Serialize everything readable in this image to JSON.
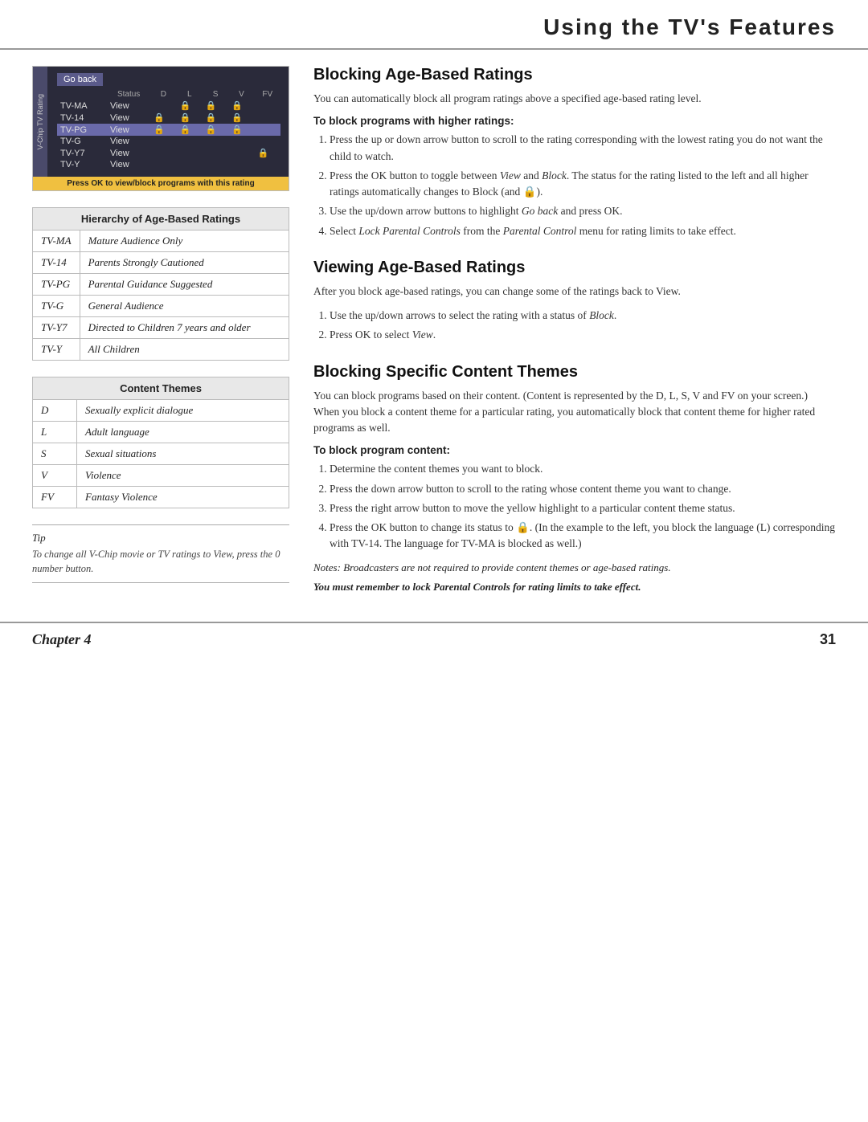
{
  "header": {
    "title": "Using the TV's Features"
  },
  "tv_screen": {
    "sidebar_label": "V-Chip TV Rating",
    "go_back": "Go back",
    "columns": [
      "Status",
      "D",
      "L",
      "S",
      "V",
      "FV"
    ],
    "rows": [
      {
        "rating": "TV-MA",
        "status": "View",
        "d": "",
        "l": "🔒",
        "s": "🔒",
        "v": "🔒",
        "fv": ""
      },
      {
        "rating": "TV-14",
        "status": "View",
        "d": "🔒",
        "l": "🔒",
        "s": "🔒",
        "v": "🔒",
        "fv": ""
      },
      {
        "rating": "TV-PG",
        "status": "View",
        "d": "🔒",
        "l": "🔒",
        "s": "🔒",
        "v": "🔒",
        "fv": "",
        "highlight": true
      },
      {
        "rating": "TV-G",
        "status": "View",
        "d": "",
        "l": "",
        "s": "",
        "v": "",
        "fv": ""
      },
      {
        "rating": "TV-Y7",
        "status": "View",
        "d": "",
        "l": "",
        "s": "",
        "v": "",
        "fv": "🔒"
      },
      {
        "rating": "TV-Y",
        "status": "View",
        "d": "",
        "l": "",
        "s": "",
        "v": "",
        "fv": ""
      }
    ],
    "footer": "Press OK to view/block programs with this rating"
  },
  "hierarchy_table": {
    "header": "Hierarchy of Age-Based Ratings",
    "rows": [
      {
        "code": "TV-MA",
        "description": "Mature Audience Only"
      },
      {
        "code": "TV-14",
        "description": "Parents Strongly Cautioned"
      },
      {
        "code": "TV-PG",
        "description": "Parental Guidance Suggested"
      },
      {
        "code": "TV-G",
        "description": "General Audience"
      },
      {
        "code": "TV-Y7",
        "description": "Directed to Children 7 years and older"
      },
      {
        "code": "TV-Y",
        "description": "All Children"
      }
    ]
  },
  "content_themes_table": {
    "header": "Content Themes",
    "rows": [
      {
        "code": "D",
        "description": "Sexually explicit dialogue"
      },
      {
        "code": "L",
        "description": "Adult language"
      },
      {
        "code": "S",
        "description": "Sexual situations"
      },
      {
        "code": "V",
        "description": "Violence"
      },
      {
        "code": "FV",
        "description": "Fantasy Violence"
      }
    ]
  },
  "blocking_age": {
    "title": "Blocking Age-Based Ratings",
    "intro": "You can automatically block all program ratings above a specified age-based rating level.",
    "subhead": "To block programs with higher ratings:",
    "steps": [
      "Press the up or down arrow button to scroll to the rating corresponding with the lowest rating you do not want the child to watch.",
      "Press the OK button to toggle between View and Block. The status for the rating listed to the left and all higher ratings automatically changes to Block (and 🔒).",
      "Use the up/down arrow buttons to highlight Go back and press OK.",
      "Select Lock Parental Controls from the Parental Control menu for rating limits to take effect."
    ]
  },
  "viewing_age": {
    "title": "Viewing Age-Based Ratings",
    "intro": "After you block age-based ratings, you can change some of the ratings back to View.",
    "steps": [
      "Use the up/down arrows to select the rating with a status of Block.",
      "Press OK to select View."
    ]
  },
  "blocking_specific": {
    "title": "Blocking Specific Content Themes",
    "intro": "You can block programs based on their content. (Content is represented by the D, L, S, V and FV on your screen.) When you block a content theme for a particular rating, you automatically block that content theme for higher rated programs as well.",
    "subhead": "To block program content:",
    "steps": [
      "Determine the content themes you want to block.",
      "Press the down arrow button to scroll to the rating whose content theme you want to change.",
      "Press the right arrow button to move the yellow highlight to a particular content theme status.",
      "Press the OK button to change its status to 🔒. (In the example to the left, you block the language (L) corresponding with TV-14. The language for TV-MA is blocked as well.)"
    ],
    "note1": "Notes: Broadcasters are not required to provide content themes or age-based ratings.",
    "note2": "You must remember to lock Parental Controls for rating limits to take effect."
  },
  "tip": {
    "label": "Tip",
    "text": "To change all V-Chip movie or TV ratings to View, press the 0 number button."
  },
  "footer": {
    "chapter": "Chapter 4",
    "page": "31"
  }
}
